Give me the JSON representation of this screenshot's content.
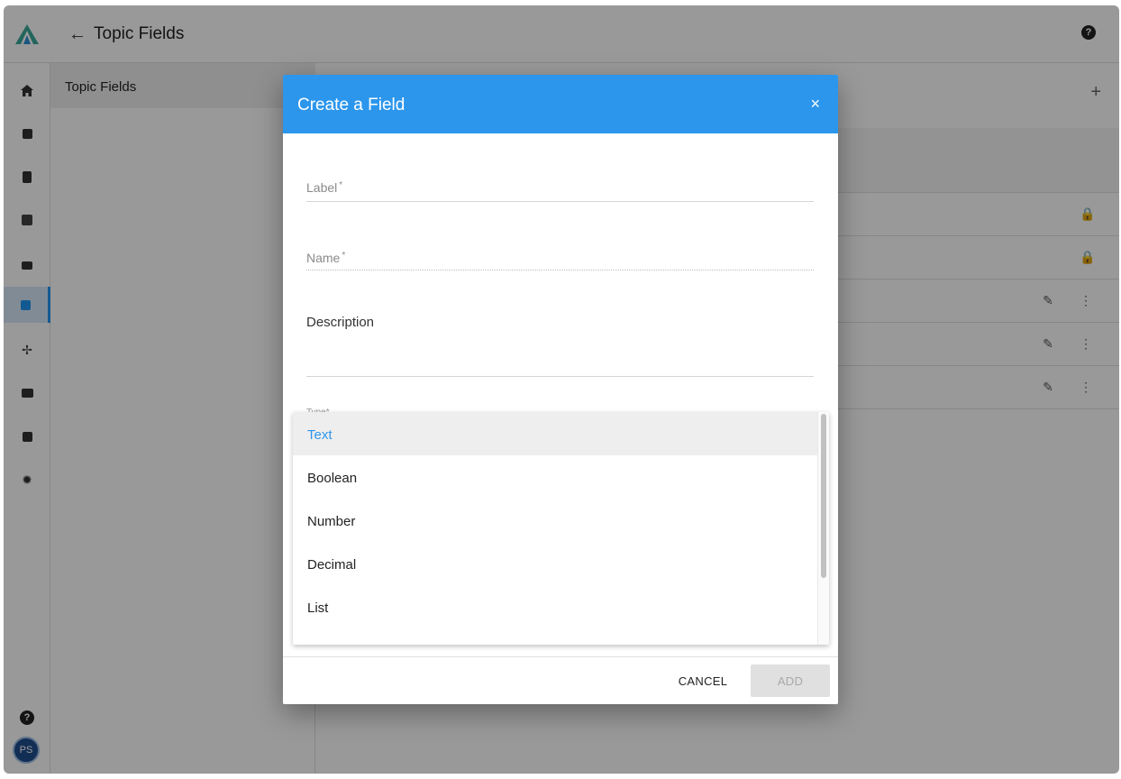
{
  "header": {
    "title": "Topic Fields",
    "back_icon": "←",
    "help_icon": "?"
  },
  "rail": {
    "help_icon": "?",
    "avatar_initials": "PS",
    "icons": [
      "home-icon",
      "chat-icon",
      "clipboard-icon",
      "grid-icon",
      "inbox-icon",
      "topic-fields-icon",
      "network-icon",
      "cards-icon",
      "chart-icon",
      "settings-icon"
    ],
    "active_index": 5
  },
  "subpanel": {
    "item": "Topic Fields"
  },
  "content": {
    "add_icon": "+",
    "rows": [
      {
        "icon": "lock"
      },
      {
        "icon": "lock"
      },
      {
        "icon": "edit-menu"
      },
      {
        "icon": "edit-menu"
      },
      {
        "icon": "edit-menu"
      }
    ]
  },
  "dialog": {
    "title": "Create a Field",
    "close_icon": "×",
    "label_field": {
      "label": "Label",
      "required_mark": "*"
    },
    "name_field": {
      "label": "Name",
      "required_mark": "*"
    },
    "description_field": {
      "label": "Description"
    },
    "type_field": {
      "label": "Type",
      "required_mark": "*"
    },
    "type_options": [
      {
        "label": "Text",
        "selected": true
      },
      {
        "label": "Boolean",
        "selected": false
      },
      {
        "label": "Number",
        "selected": false
      },
      {
        "label": "Decimal",
        "selected": false
      },
      {
        "label": "List",
        "selected": false
      }
    ],
    "cancel_label": "CANCEL",
    "add_label": "ADD"
  },
  "colors": {
    "accent": "#2c96ec",
    "overlay": "rgba(0,0,0,0.40)"
  }
}
